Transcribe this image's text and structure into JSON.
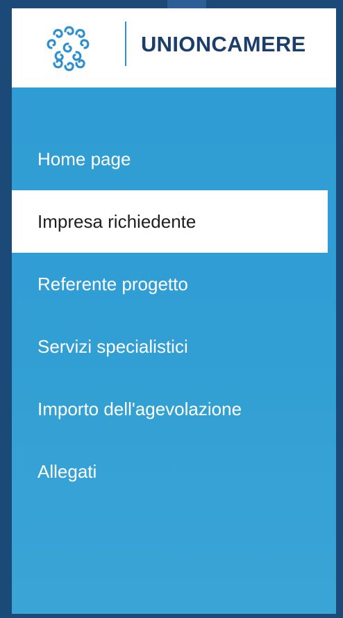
{
  "brand": {
    "name": "UNIONCAMERE",
    "logo_icon": "unioncamere-swirl-logo",
    "colors": {
      "frame": "#1c4a78",
      "nav_background": "#319fd4",
      "logo_blue": "#2e8fcf",
      "text_dark": "#1b3e6a"
    }
  },
  "nav": {
    "items": [
      {
        "label": "Home page",
        "active": false
      },
      {
        "label": "Impresa richiedente",
        "active": true
      },
      {
        "label": "Referente progetto",
        "active": false
      },
      {
        "label": "Servizi specialistici",
        "active": false
      },
      {
        "label": "Importo dell'agevolazione",
        "active": false
      },
      {
        "label": "Allegati",
        "active": false
      }
    ]
  }
}
